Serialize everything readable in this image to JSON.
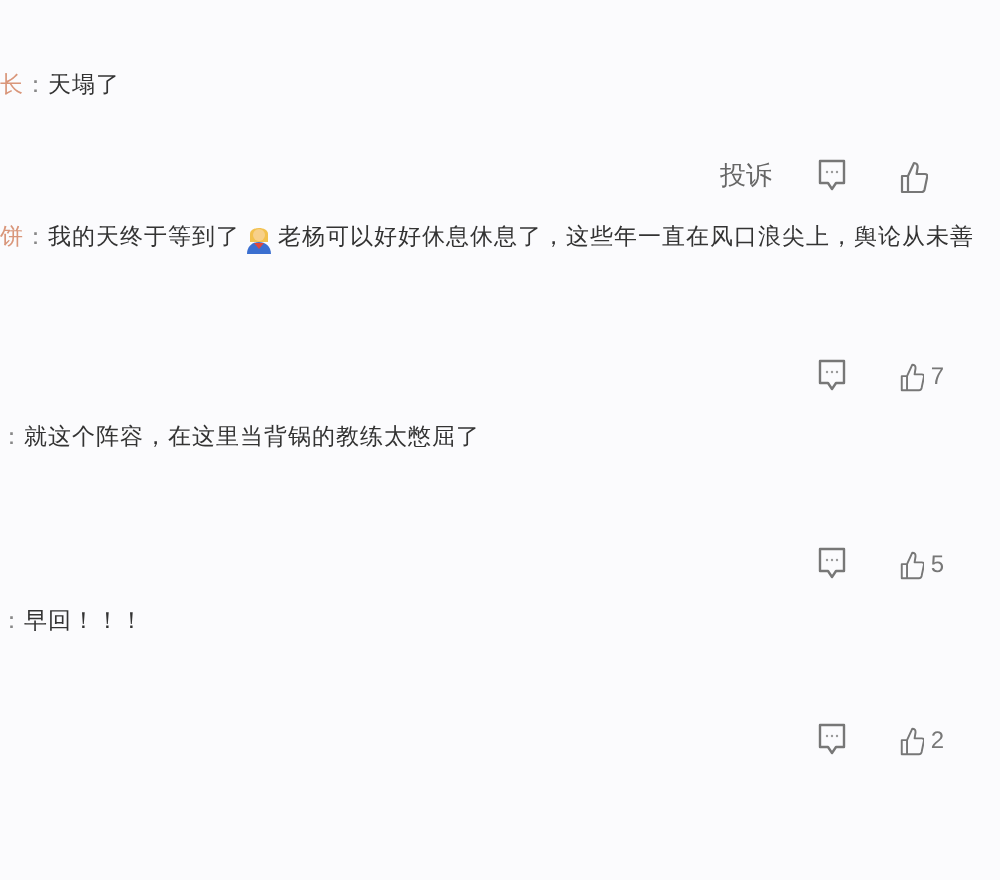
{
  "comments": [
    {
      "author": "长",
      "separator": "：",
      "parts": [
        {
          "kind": "text",
          "text": "天塌了"
        }
      ],
      "report": "投诉"
    },
    {
      "author": "饼",
      "separator": "：",
      "parts": [
        {
          "kind": "text",
          "text": "我的天终于等到了"
        },
        {
          "kind": "emoji"
        },
        {
          "kind": "text",
          "text": "老杨可以好好休息休息了，这些年一直在风口浪尖上，舆论从未善"
        }
      ],
      "likes": "7"
    },
    {
      "separator": "：",
      "parts": [
        {
          "kind": "text",
          "text": "就这个阵容，在这里当背锅的教练太憋屈了"
        }
      ],
      "likes": "5"
    },
    {
      "separator": "：",
      "parts": [
        {
          "kind": "text",
          "text": "早回！！！"
        }
      ],
      "likes": "2"
    }
  ]
}
